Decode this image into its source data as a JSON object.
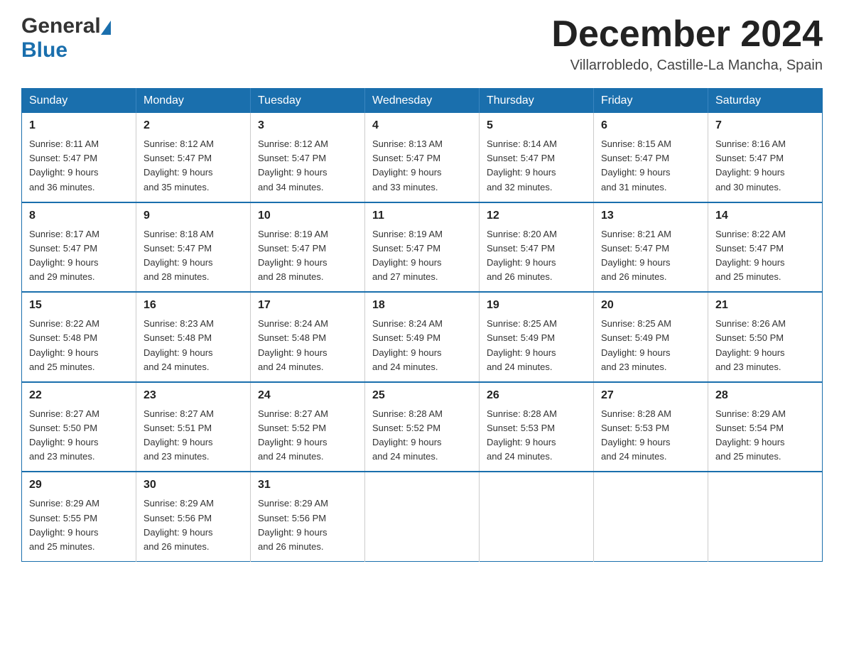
{
  "header": {
    "logo_general": "General",
    "logo_blue": "Blue",
    "month_title": "December 2024",
    "location": "Villarrobledo, Castille-La Mancha, Spain"
  },
  "weekdays": [
    "Sunday",
    "Monday",
    "Tuesday",
    "Wednesday",
    "Thursday",
    "Friday",
    "Saturday"
  ],
  "weeks": [
    [
      {
        "day": "1",
        "sunrise": "8:11 AM",
        "sunset": "5:47 PM",
        "daylight": "9 hours and 36 minutes."
      },
      {
        "day": "2",
        "sunrise": "8:12 AM",
        "sunset": "5:47 PM",
        "daylight": "9 hours and 35 minutes."
      },
      {
        "day": "3",
        "sunrise": "8:12 AM",
        "sunset": "5:47 PM",
        "daylight": "9 hours and 34 minutes."
      },
      {
        "day": "4",
        "sunrise": "8:13 AM",
        "sunset": "5:47 PM",
        "daylight": "9 hours and 33 minutes."
      },
      {
        "day": "5",
        "sunrise": "8:14 AM",
        "sunset": "5:47 PM",
        "daylight": "9 hours and 32 minutes."
      },
      {
        "day": "6",
        "sunrise": "8:15 AM",
        "sunset": "5:47 PM",
        "daylight": "9 hours and 31 minutes."
      },
      {
        "day": "7",
        "sunrise": "8:16 AM",
        "sunset": "5:47 PM",
        "daylight": "9 hours and 30 minutes."
      }
    ],
    [
      {
        "day": "8",
        "sunrise": "8:17 AM",
        "sunset": "5:47 PM",
        "daylight": "9 hours and 29 minutes."
      },
      {
        "day": "9",
        "sunrise": "8:18 AM",
        "sunset": "5:47 PM",
        "daylight": "9 hours and 28 minutes."
      },
      {
        "day": "10",
        "sunrise": "8:19 AM",
        "sunset": "5:47 PM",
        "daylight": "9 hours and 28 minutes."
      },
      {
        "day": "11",
        "sunrise": "8:19 AM",
        "sunset": "5:47 PM",
        "daylight": "9 hours and 27 minutes."
      },
      {
        "day": "12",
        "sunrise": "8:20 AM",
        "sunset": "5:47 PM",
        "daylight": "9 hours and 26 minutes."
      },
      {
        "day": "13",
        "sunrise": "8:21 AM",
        "sunset": "5:47 PM",
        "daylight": "9 hours and 26 minutes."
      },
      {
        "day": "14",
        "sunrise": "8:22 AM",
        "sunset": "5:47 PM",
        "daylight": "9 hours and 25 minutes."
      }
    ],
    [
      {
        "day": "15",
        "sunrise": "8:22 AM",
        "sunset": "5:48 PM",
        "daylight": "9 hours and 25 minutes."
      },
      {
        "day": "16",
        "sunrise": "8:23 AM",
        "sunset": "5:48 PM",
        "daylight": "9 hours and 24 minutes."
      },
      {
        "day": "17",
        "sunrise": "8:24 AM",
        "sunset": "5:48 PM",
        "daylight": "9 hours and 24 minutes."
      },
      {
        "day": "18",
        "sunrise": "8:24 AM",
        "sunset": "5:49 PM",
        "daylight": "9 hours and 24 minutes."
      },
      {
        "day": "19",
        "sunrise": "8:25 AM",
        "sunset": "5:49 PM",
        "daylight": "9 hours and 24 minutes."
      },
      {
        "day": "20",
        "sunrise": "8:25 AM",
        "sunset": "5:49 PM",
        "daylight": "9 hours and 23 minutes."
      },
      {
        "day": "21",
        "sunrise": "8:26 AM",
        "sunset": "5:50 PM",
        "daylight": "9 hours and 23 minutes."
      }
    ],
    [
      {
        "day": "22",
        "sunrise": "8:27 AM",
        "sunset": "5:50 PM",
        "daylight": "9 hours and 23 minutes."
      },
      {
        "day": "23",
        "sunrise": "8:27 AM",
        "sunset": "5:51 PM",
        "daylight": "9 hours and 23 minutes."
      },
      {
        "day": "24",
        "sunrise": "8:27 AM",
        "sunset": "5:52 PM",
        "daylight": "9 hours and 24 minutes."
      },
      {
        "day": "25",
        "sunrise": "8:28 AM",
        "sunset": "5:52 PM",
        "daylight": "9 hours and 24 minutes."
      },
      {
        "day": "26",
        "sunrise": "8:28 AM",
        "sunset": "5:53 PM",
        "daylight": "9 hours and 24 minutes."
      },
      {
        "day": "27",
        "sunrise": "8:28 AM",
        "sunset": "5:53 PM",
        "daylight": "9 hours and 24 minutes."
      },
      {
        "day": "28",
        "sunrise": "8:29 AM",
        "sunset": "5:54 PM",
        "daylight": "9 hours and 25 minutes."
      }
    ],
    [
      {
        "day": "29",
        "sunrise": "8:29 AM",
        "sunset": "5:55 PM",
        "daylight": "9 hours and 25 minutes."
      },
      {
        "day": "30",
        "sunrise": "8:29 AM",
        "sunset": "5:56 PM",
        "daylight": "9 hours and 26 minutes."
      },
      {
        "day": "31",
        "sunrise": "8:29 AM",
        "sunset": "5:56 PM",
        "daylight": "9 hours and 26 minutes."
      },
      null,
      null,
      null,
      null
    ]
  ],
  "labels": {
    "sunrise": "Sunrise:",
    "sunset": "Sunset:",
    "daylight": "Daylight:"
  }
}
